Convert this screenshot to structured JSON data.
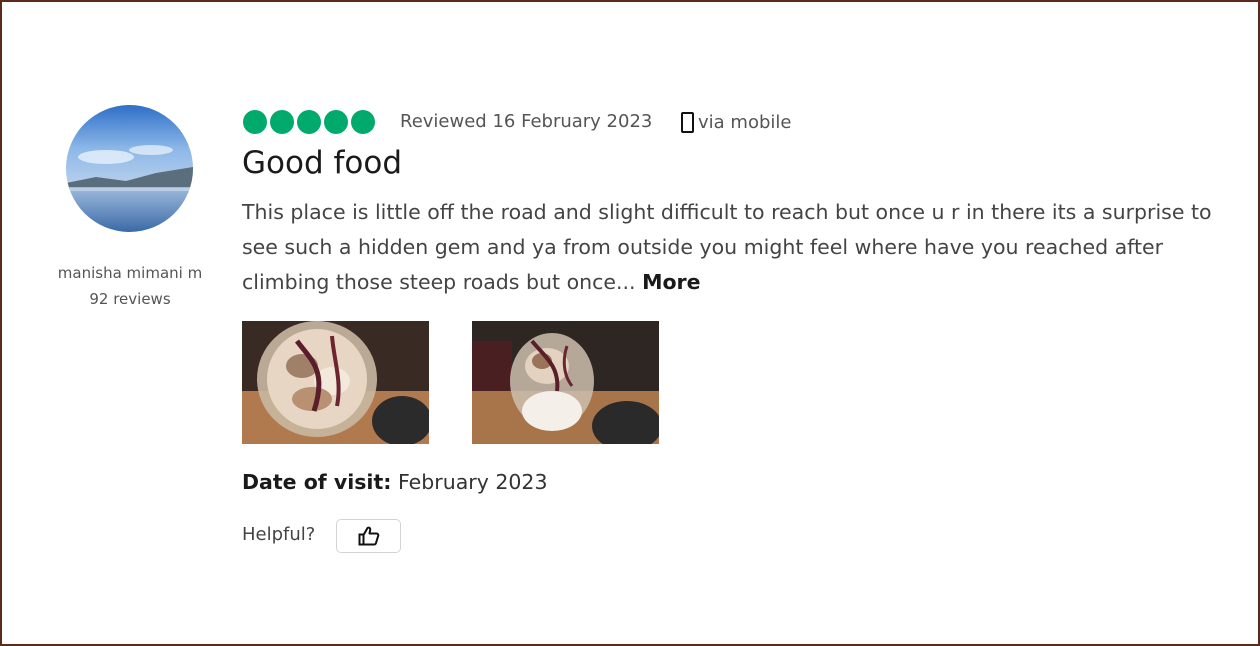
{
  "user": {
    "name": "manisha mimani m",
    "reviews": "92 reviews"
  },
  "review": {
    "rating": 5,
    "rating_max": 5,
    "rating_color": "#00aa6c",
    "reviewed_date": "Reviewed 16 February 2023",
    "device": "via mobile",
    "title": "Good food",
    "body": "This place is little off the road and slight difficult to reach but once u r in there its a surprise to see such a hidden gem and ya from outside you might feel where have you reached after climbing those steep roads but once...",
    "more_label": "More",
    "date_of_visit_label": "Date of visit:",
    "date_of_visit_value": "February 2023",
    "helpful_label": "Helpful?"
  },
  "icons": {
    "device": "mobile-phone-icon",
    "helpful": "thumbs-up-icon"
  }
}
